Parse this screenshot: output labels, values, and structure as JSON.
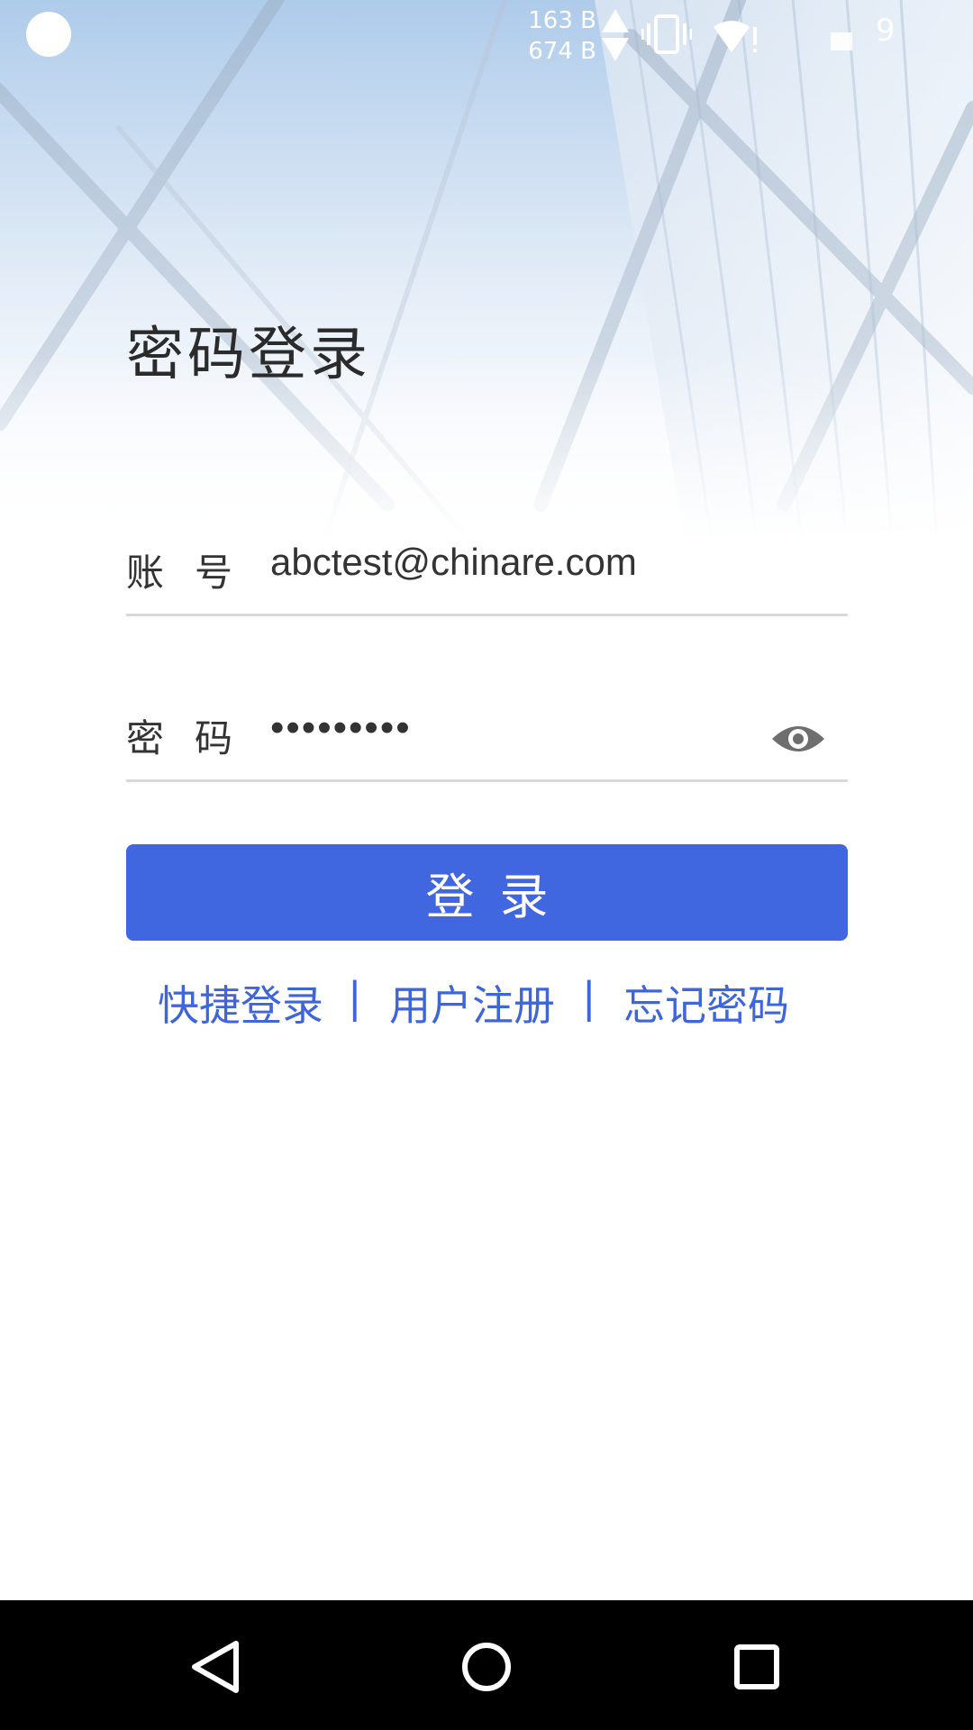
{
  "status_bar": {
    "upload_speed": "163 B",
    "download_speed": "674 B",
    "clock": "9"
  },
  "title": "密码登录",
  "account_field": {
    "label": "账号",
    "value": "abctest@chinare.com"
  },
  "password_field": {
    "label": "密码",
    "value": "•••••••••"
  },
  "login_button": "登录",
  "links": {
    "quick_login": "快捷登录",
    "separator": "|",
    "register": "用户注册",
    "forgot_password": "忘记密码"
  },
  "colors": {
    "primary": "#4167e0",
    "link": "#3f66d8",
    "nav_bar": "#000000"
  },
  "icons": {
    "password_toggle": "eye-icon",
    "nav_back": "back-triangle-icon",
    "nav_home": "home-circle-icon",
    "nav_recents": "recents-square-icon"
  }
}
